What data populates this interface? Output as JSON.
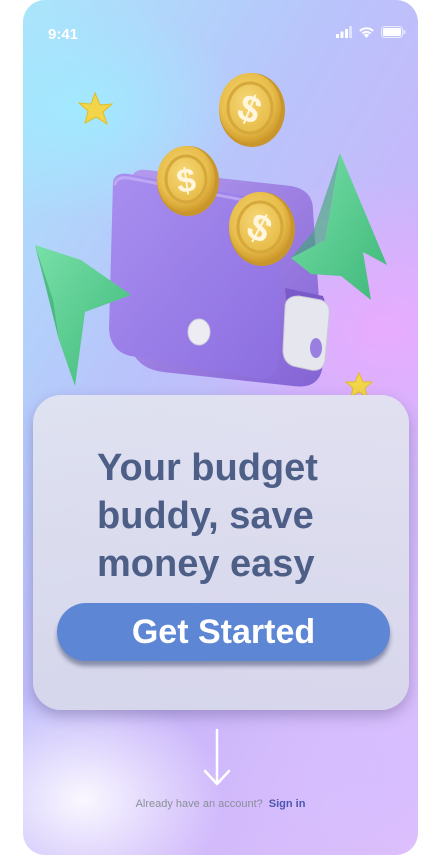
{
  "status_bar": {
    "time": "9:41",
    "icons": [
      "cellular-signal-icon",
      "wifi-icon",
      "battery-icon"
    ]
  },
  "illustration": {
    "subject": "purple-wallet-with-gold-dollar-coins-and-green-arrows",
    "coin_symbol": "$",
    "colors": {
      "wallet": "#9b7ae0",
      "coin": "#e8be4c",
      "arrow": "#55cf8e",
      "star": "#f2d548"
    }
  },
  "hero": {
    "headline_line1": "Your budget",
    "headline_line2": "buddy, save",
    "headline_line3": "money easy",
    "cta_label": "Get Started"
  },
  "footer": {
    "prompt": "Already have an account?",
    "link": "Sign in"
  },
  "colors": {
    "headline": "#4d5f87",
    "cta_background": "#5d86d4",
    "link": "#4a56b0"
  }
}
